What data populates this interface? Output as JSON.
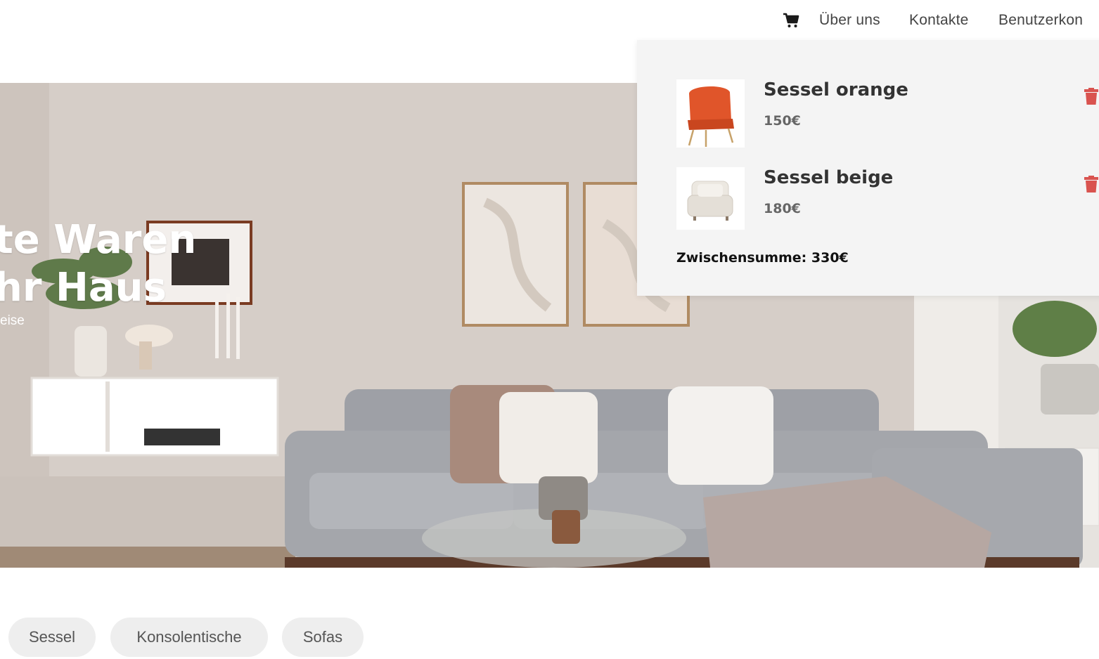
{
  "nav": {
    "cart_icon": "shopping-cart-icon",
    "about": "Über uns",
    "contacts": "Kontakte",
    "account": "Benutzerkon"
  },
  "hero": {
    "title_line1": "te Waren",
    "title_line2": "hr Haus",
    "subtitle": "eise"
  },
  "cart": {
    "items": [
      {
        "name": "Sessel orange",
        "price": "150€",
        "image": "orange-armchair",
        "color": "#e0552a"
      },
      {
        "name": "Sessel beige",
        "price": "180€",
        "image": "beige-armchair",
        "color": "#ece8e1"
      }
    ],
    "trash_icon": "trash-icon",
    "trash_color": "#d9534f",
    "subtotal": "Zwischensumme: 330€"
  },
  "categories": [
    "Sessel",
    "Konsolentische",
    "Sofas"
  ]
}
